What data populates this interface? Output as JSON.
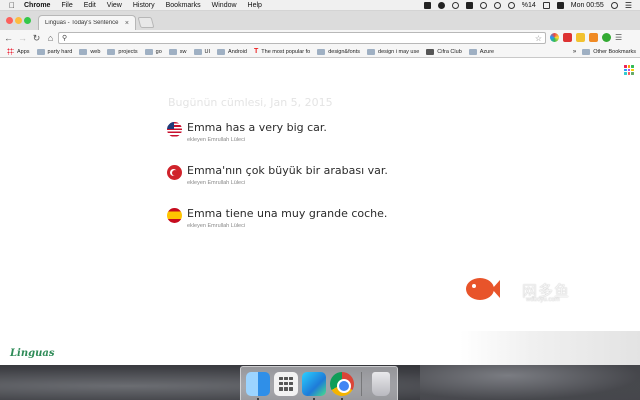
{
  "menubar": {
    "app_name": "Chrome",
    "menus": [
      "File",
      "Edit",
      "View",
      "History",
      "Bookmarks",
      "Window",
      "Help"
    ],
    "battery": "%14",
    "clock": "Mon 00:55"
  },
  "browser": {
    "tab_title": "Linguas - Today's Sentence",
    "address_value": "",
    "bookmarks": [
      {
        "label": "Apps",
        "kind": "apps"
      },
      {
        "label": "party hard",
        "kind": "folder"
      },
      {
        "label": "web",
        "kind": "folder"
      },
      {
        "label": "projects",
        "kind": "folder"
      },
      {
        "label": "go",
        "kind": "folder"
      },
      {
        "label": "sw",
        "kind": "folder"
      },
      {
        "label": "UI",
        "kind": "folder"
      },
      {
        "label": "Android",
        "kind": "folder"
      },
      {
        "label": "The most popular fo",
        "kind": "t-logo"
      },
      {
        "label": "design&fonts",
        "kind": "folder"
      },
      {
        "label": "design i may use",
        "kind": "folder"
      },
      {
        "label": "Cifra Club",
        "kind": "cifra"
      },
      {
        "label": "Azure",
        "kind": "folder"
      }
    ],
    "other_bookmarks": "Other Bookmarks"
  },
  "page": {
    "date_line": "Bugünün cümlesi, Jan 5, 2015",
    "sentences": [
      {
        "flag": "us",
        "text": "Emma has a very big car.",
        "author": "ekleyen Emrullah Lüleci"
      },
      {
        "flag": "tr",
        "text": "Emma'nın çok büyük bir arabası var.",
        "author": "ekleyen Emrullah Lüleci"
      },
      {
        "flag": "es",
        "text": "Emma tiene una muy grande coche.",
        "author": "ekleyen Emrullah Lüleci"
      }
    ],
    "brand": "Linguas"
  },
  "watermark": {
    "text": "网多鱼",
    "sub": "wduoyu.com",
    "badge": "CZ"
  },
  "colors": {
    "brand_green": "#2e8b57",
    "date_gray": "#e4e4e4"
  }
}
